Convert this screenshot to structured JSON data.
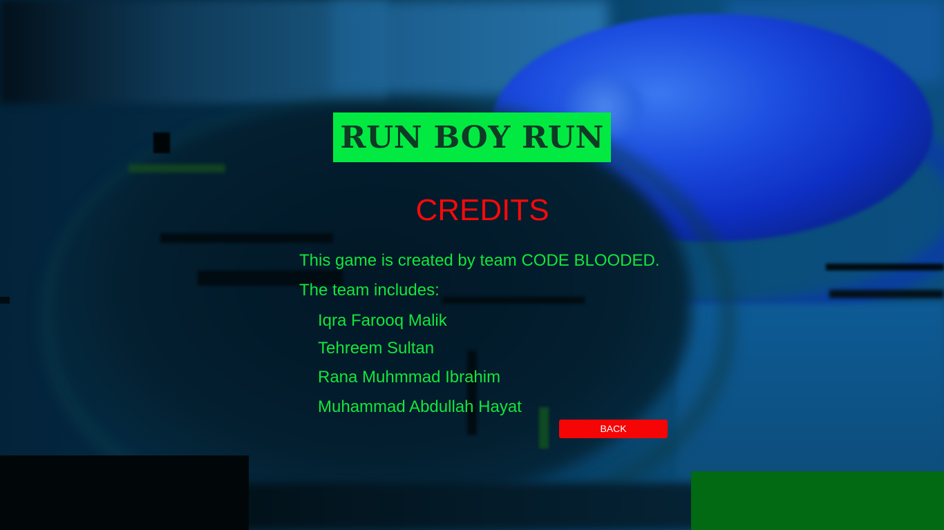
{
  "logo": {
    "text": "RUN BOY RUN"
  },
  "title": "CREDITS",
  "intro": "This game is created by team CODE BLOODED.",
  "team_heading": "The team includes:",
  "members": [
    "Iqra Farooq Malik",
    "Tehreem Sultan",
    "Rana Muhmmad Ibrahim",
    "Muhammad Abdullah Hayat"
  ],
  "back_button": "BACK",
  "colors": {
    "logo_background": "#02ea42",
    "logo_text": "#103a26",
    "title": "#f50a0a",
    "body_text": "#14e63c",
    "button_background": "#f50505",
    "button_text": "#ffffff"
  }
}
